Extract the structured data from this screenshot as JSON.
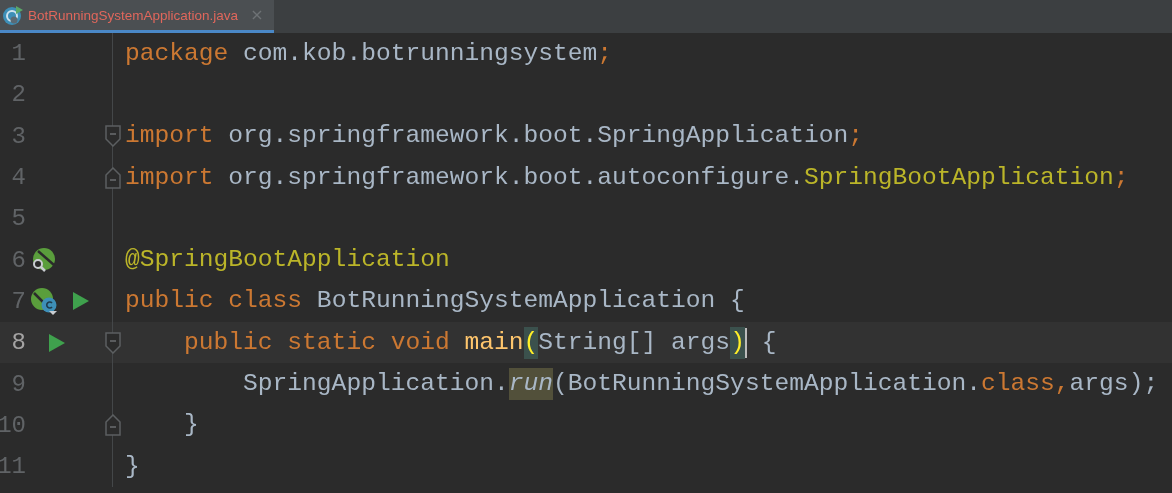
{
  "tabs": [
    {
      "label": "BotRunningSystemApplication.java",
      "selected": true,
      "close": "×"
    }
  ],
  "lines": [
    {
      "number": "1",
      "current": false,
      "fold_start": false,
      "fold_end": false,
      "tokens": [
        {
          "kind": "keyword",
          "text": "package"
        },
        {
          "kind": "plain",
          "text": " com.kob.botrunningsystem"
        },
        {
          "kind": "keyword",
          "text": ";"
        }
      ]
    },
    {
      "number": "2",
      "current": false,
      "fold_start": false,
      "fold_end": false
    },
    {
      "number": "3",
      "current": false,
      "fold_start": true,
      "fold_end": false,
      "tokens": [
        {
          "kind": "keyword",
          "text": "import"
        },
        {
          "kind": "plain",
          "text": " org.springframework.boot.SpringApplication"
        },
        {
          "kind": "keyword",
          "text": ";"
        }
      ]
    },
    {
      "number": "4",
      "current": false,
      "fold_start": false,
      "fold_end": true,
      "tokens": [
        {
          "kind": "keyword",
          "text": "import"
        },
        {
          "kind": "plain",
          "text": " org.springframework.boot.autoconfigure."
        },
        {
          "kind": "annotation",
          "text": "SpringBootApplication"
        },
        {
          "kind": "keyword",
          "text": ";"
        }
      ]
    },
    {
      "number": "5",
      "current": false,
      "fold_start": false,
      "fold_end": false
    },
    {
      "number": "6",
      "current": false,
      "fold_start": false,
      "fold_end": false,
      "gutter": [
        {
          "kind": "bean-search"
        }
      ],
      "tokens": [
        {
          "kind": "annotation",
          "text": "@SpringBootApplication"
        }
      ]
    },
    {
      "number": "7",
      "current": false,
      "fold_start": false,
      "fold_end": false,
      "gutter": [
        {
          "kind": "bean-class"
        },
        {
          "kind": "run"
        }
      ],
      "tokens": [
        {
          "kind": "keyword",
          "text": "public class"
        },
        {
          "kind": "plain",
          "text": " BotRunningSystemApplication {"
        }
      ]
    },
    {
      "number": "8",
      "current": true,
      "fold_start": true,
      "fold_end": false,
      "gutter": [
        {
          "kind": "run"
        }
      ],
      "tokens": [
        {
          "kind": "keyword",
          "text": "    public static void "
        },
        {
          "kind": "method",
          "text": "main"
        },
        {
          "kind": "paren-match",
          "text": "("
        },
        {
          "kind": "plain",
          "text": "String[] args"
        },
        {
          "kind": "paren-match",
          "text": ")"
        },
        {
          "kind": "caret"
        },
        {
          "kind": "plain",
          "text": " {"
        }
      ]
    },
    {
      "number": "9",
      "current": false,
      "fold_start": false,
      "fold_end": false,
      "tokens": [
        {
          "kind": "plain",
          "text": "        SpringApplication."
        },
        {
          "kind": "usage",
          "text": "run"
        },
        {
          "kind": "plain",
          "text": "(BotRunningSystemApplication."
        },
        {
          "kind": "keyword",
          "text": "class,"
        },
        {
          "kind": "plain",
          "text": "args);"
        }
      ]
    },
    {
      "number": "10",
      "current": false,
      "fold_start": false,
      "fold_end": true,
      "tokens": [
        {
          "kind": "plain",
          "text": "    }"
        }
      ]
    },
    {
      "number": "11",
      "current": false,
      "fold_start": false,
      "fold_end": false,
      "tokens": [
        {
          "kind": "plain",
          "text": "}"
        }
      ]
    }
  ]
}
